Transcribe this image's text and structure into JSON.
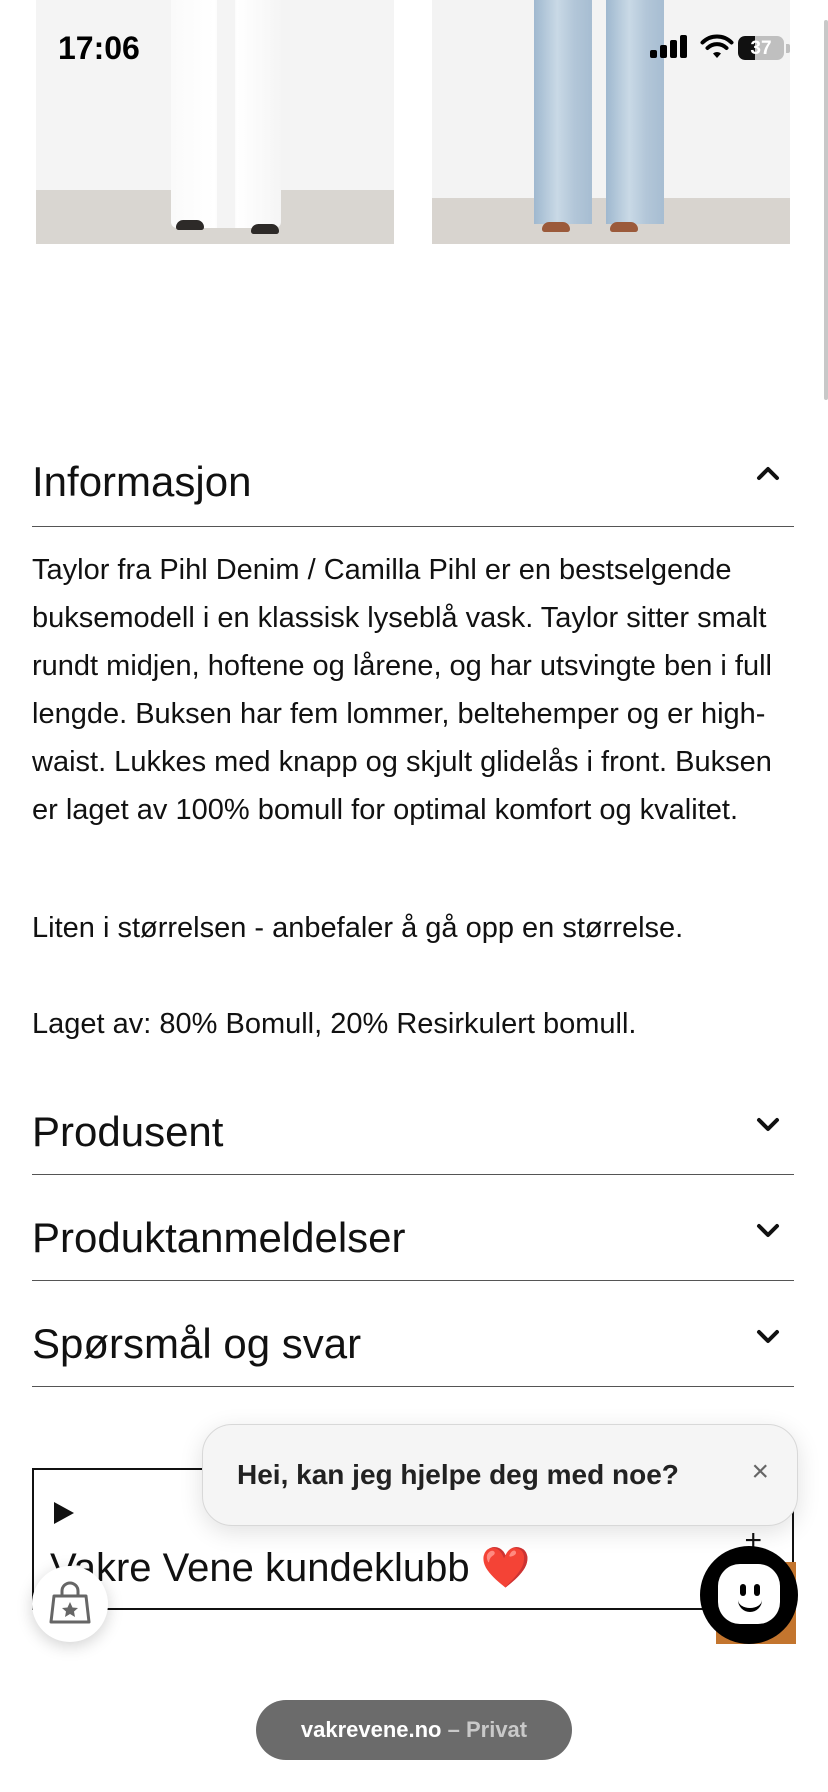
{
  "status_bar": {
    "time": "17:06",
    "battery": "37",
    "battery_level": 0.37
  },
  "accordion": {
    "informasjon": {
      "title": "Informasjon",
      "expanded": true,
      "description": "Taylor fra Pihl Denim / Camilla Pihl er en bestselgende buksemodell i en klassisk lyseblå vask. Taylor sitter smalt rundt midjen, hoftene og lårene, og har utsvingte ben i full lengde. Buksen har fem lommer, beltehemper og er high-waist. Lukkes med knapp og skjult glidelås i front. Buksen er laget av 100% bomull for optimal komfort og kvalitet.",
      "size_note": "Liten i størrelsen - anbefaler å gå opp en størrelse.",
      "material": "Laget av: 80% Bomull, 20% Resirkulert bomull."
    },
    "produsent": {
      "title": "Produsent",
      "expanded": false
    },
    "produktanmeldelser": {
      "title": "Produktanmeldelser",
      "expanded": false
    },
    "sporsmal": {
      "title": "Spørsmål og svar",
      "expanded": false
    }
  },
  "club": {
    "title": "Vakre Vene kundeklubb",
    "heart": "❤️",
    "plus": "+"
  },
  "chat": {
    "message": "Hei, kan jeg hjelpe deg med noe?",
    "close": "×"
  },
  "browser": {
    "domain": "vakrevene.no",
    "mode": "– Privat"
  },
  "colors": {
    "heart": "#d0121b",
    "chat_accent": "#c3752e",
    "url_bar": "#6b6b6b"
  }
}
